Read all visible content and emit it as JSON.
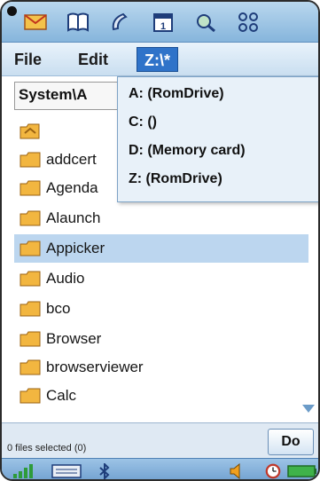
{
  "menu": {
    "file_label": "File",
    "edit_label": "Edit",
    "drive_label": "Z:\\*"
  },
  "path": {
    "text": "System\\A"
  },
  "drive_dropdown": {
    "items": [
      "A: (RomDrive)",
      "C: ()",
      "D: (Memory card)",
      "Z: (RomDrive)"
    ]
  },
  "files": [
    {
      "name": "addcert"
    },
    {
      "name": "Agenda"
    },
    {
      "name": "Alaunch"
    },
    {
      "name": "Appicker",
      "selected": true
    },
    {
      "name": "Audio"
    },
    {
      "name": "bco"
    },
    {
      "name": "Browser"
    },
    {
      "name": "browserviewer"
    },
    {
      "name": "Calc"
    }
  ],
  "status": {
    "text": "0 files selected (0)"
  },
  "command": {
    "do_label": "Do"
  },
  "colors": {
    "selection": "#bcd6ef",
    "menu_highlight": "#2f73c9",
    "folder": "#f2b640"
  },
  "icons": {
    "appbar": [
      "mail-icon",
      "contacts-book-icon",
      "phone-icon",
      "calendar-icon",
      "search-icon",
      "apps-grid-icon"
    ],
    "tray": [
      "signal-strength-icon",
      "keyboard-icon",
      "bluetooth-icon",
      "speaker-icon",
      "clock-icon",
      "battery-icon"
    ]
  }
}
